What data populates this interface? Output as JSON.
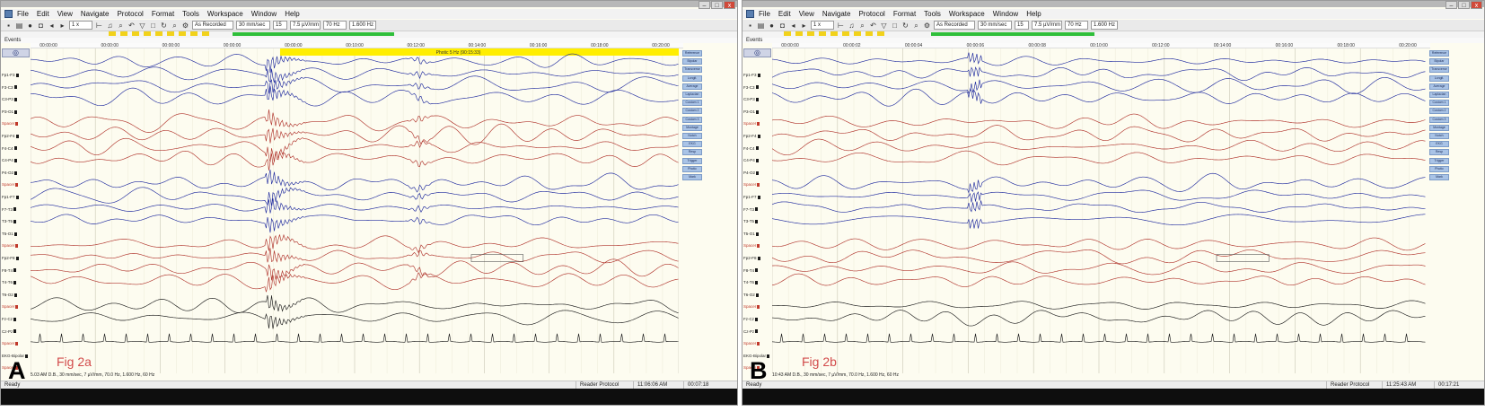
{
  "app": {
    "menu": [
      "File",
      "Edit",
      "View",
      "Navigate",
      "Protocol",
      "Format",
      "Tools",
      "Workspace",
      "Window",
      "Help"
    ],
    "window_buttons": [
      "–",
      "□",
      "x"
    ],
    "events_label": "Events",
    "left_header_icon": "montage-icon",
    "status_ready": "Ready",
    "status_protocol": "Reader Protocol"
  },
  "channels": [
    "Fp1-F3",
    "F3-C3",
    "C3-P3",
    "P3-O1",
    "Spacer",
    "Fp2-F4",
    "F4-C4",
    "C4-P4",
    "P4-O2",
    "Spacer",
    "Fp1-F7",
    "F7-T3",
    "T3-T5",
    "T5-O1",
    "Spacer",
    "Fp2-F8",
    "F8-T4",
    "T4-T6",
    "T6-O2",
    "Spacer",
    "Fz-Cz",
    "Cz-Pz",
    "Spacer",
    "EKG-Bipolar",
    "Spacer"
  ],
  "panels": [
    {
      "letter": "A",
      "fig_label": "Fig 2a",
      "toolbar": {
        "play_speed": "1 x",
        "view_mode": "As Recorded",
        "timebase": "30 mm/sec",
        "page": "15",
        "sensitivity": "7.5 µV/mm",
        "lff": "70 Hz",
        "hff": "1.600 Hz"
      },
      "timeline": [
        "00:00:00",
        "00:00:00",
        "00:00:00",
        "00:00:00",
        "00:00:00",
        "00:10:00",
        "00:12:00",
        "00:14:00",
        "00:16:00",
        "00:18:00",
        "00:20:00"
      ],
      "photic_label": "Photic 5 Hz (90:15:33)",
      "info_line": "5.03 AM D.B., 30 mm/sec, 7 µV/mm, 70.0 Hz, 1.600 Hz, 60 Hz",
      "status_time": "11:06:06 AM",
      "status_page": "00:07:18",
      "side_buttons": [
        "Reference",
        "Bipolar",
        "Transverse",
        "Longit.",
        "Average",
        "Laplacian",
        "Custom 1",
        "Custom 2",
        "Custom 3",
        "Montage",
        "Notch",
        "EKG",
        "Resp",
        "Trigger",
        "Photic",
        "Mark"
      ]
    },
    {
      "letter": "B",
      "fig_label": "Fig 2b",
      "toolbar": {
        "play_speed": "1 x",
        "view_mode": "As Recorded",
        "timebase": "30 mm/sec",
        "page": "15",
        "sensitivity": "7.5 µV/mm",
        "lff": "70 Hz",
        "hff": "1.600 Hz"
      },
      "timeline": [
        "00:00:00",
        "00:00:02",
        "00:00:04",
        "00:00:06",
        "00:00:08",
        "00:10:00",
        "00:12:00",
        "00:14:00",
        "00:16:00",
        "00:18:00",
        "00:20:00"
      ],
      "info_line": "10:43 AM D.B., 30 mm/sec, 7 µV/mm, 70.0 Hz, 1.600 Hz, 60 Hz",
      "status_time": "11:25:43 AM",
      "status_page": "00:17:21",
      "side_buttons": [
        "Reference",
        "Bipolar",
        "Transverse",
        "Longit.",
        "Average",
        "Laplacian",
        "Custom 1",
        "Custom 2",
        "Custom 3",
        "Montage",
        "Notch",
        "EKG",
        "Resp",
        "Trigger",
        "Photic",
        "Mark"
      ]
    }
  ],
  "colors": {
    "trace_blue": "#1f2a9e",
    "trace_red": "#b0342c",
    "trace_black": "#1a1a1a",
    "grid_bg": "#fdfcf0",
    "photic_bar": "#ffee00",
    "green_bar": "#2fbf3a"
  }
}
